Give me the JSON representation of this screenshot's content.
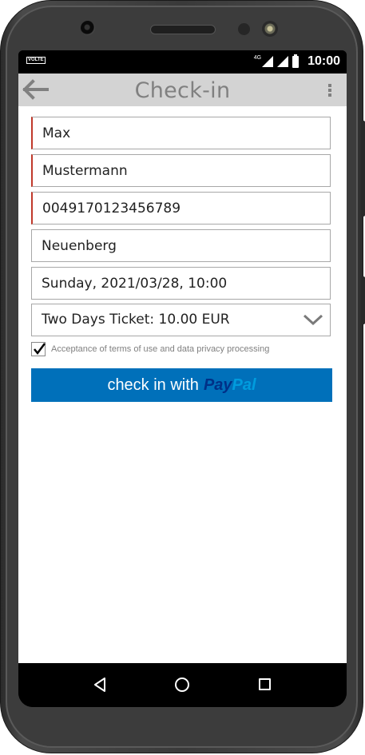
{
  "status_bar": {
    "volte": "VOLTE",
    "network": "4G",
    "time": "10:00"
  },
  "app_bar": {
    "title": "Check-in"
  },
  "form": {
    "first_name": "Max",
    "last_name": "Mustermann",
    "phone": "0049170123456789",
    "city": "Neuenberg",
    "date": "Sunday, 2021/03/28, 10:00",
    "ticket": "Two Days Ticket: 10.00 EUR",
    "terms_label": "Acceptance of terms of use and data privacy processing",
    "terms_checked": true
  },
  "pay_button": {
    "label": "check in with",
    "brand_pay": "Pay",
    "brand_pal": "Pal"
  },
  "colors": {
    "paypal_button": "#0070ba",
    "paypal_dark": "#003087",
    "paypal_light": "#009cde",
    "app_bar": "#d3d3d3",
    "required_marker": "#c0392b"
  },
  "icons": [
    "back-arrow-icon",
    "more-vert-icon",
    "chevron-down-icon",
    "checkmark-icon",
    "nav-back-icon",
    "nav-home-icon",
    "nav-recent-icon",
    "signal-icon",
    "battery-icon"
  ]
}
